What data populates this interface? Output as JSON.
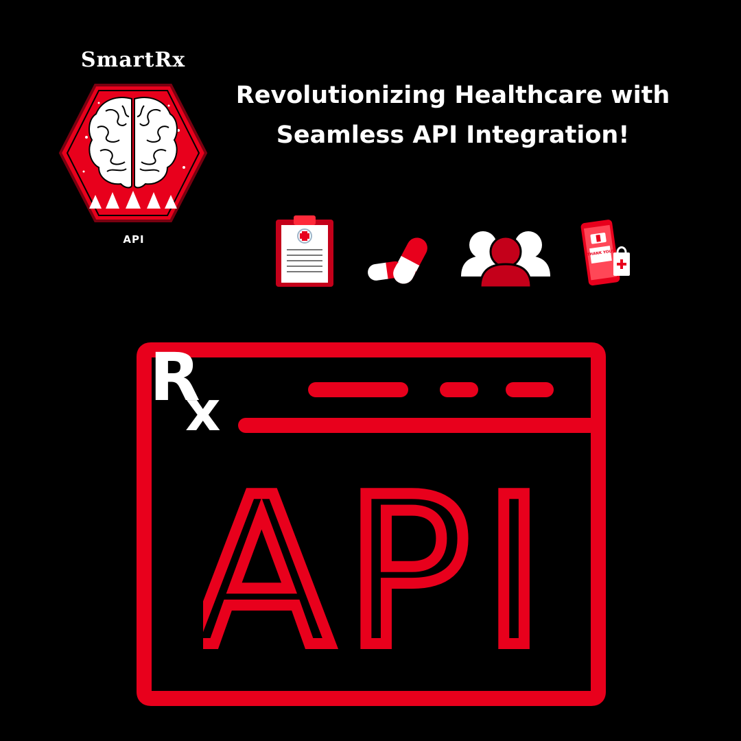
{
  "brand": {
    "name": "SmartRx",
    "logo_caption": "API"
  },
  "headline": {
    "line1": "Revolutionizing Healthcare with",
    "line2": "Seamless API Integration!"
  },
  "icons": [
    {
      "name": "clipboard-icon"
    },
    {
      "name": "pills-icon"
    },
    {
      "name": "patients-icon"
    },
    {
      "name": "phone-shopping-icon",
      "text": "THANK YOU!"
    }
  ],
  "api_window": {
    "symbol": "Rx",
    "label": "API"
  },
  "colors": {
    "background": "#000000",
    "accent": "#e8001c",
    "text": "#ffffff"
  }
}
